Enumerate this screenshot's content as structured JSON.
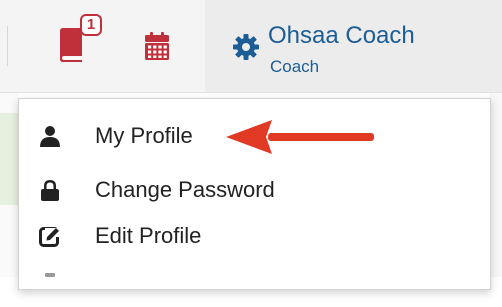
{
  "navbar": {
    "messages": {
      "icon": "book-icon",
      "badge_count": "1",
      "color": "#c0303a"
    },
    "calendar": {
      "icon": "calendar-icon",
      "color": "#c0303a"
    },
    "user": {
      "icon": "gear-icon",
      "name": "Ohsaa Coach",
      "role": "Coach",
      "color": "#1d5d96"
    }
  },
  "dropdown": {
    "items": [
      {
        "label": "My Profile",
        "icon": "user-icon"
      },
      {
        "label": "Change Password",
        "icon": "lock-icon"
      },
      {
        "label": "Edit Profile",
        "icon": "edit-icon"
      }
    ]
  },
  "annotation": {
    "icon": "arrow-left-icon",
    "color": "#e03a25"
  }
}
